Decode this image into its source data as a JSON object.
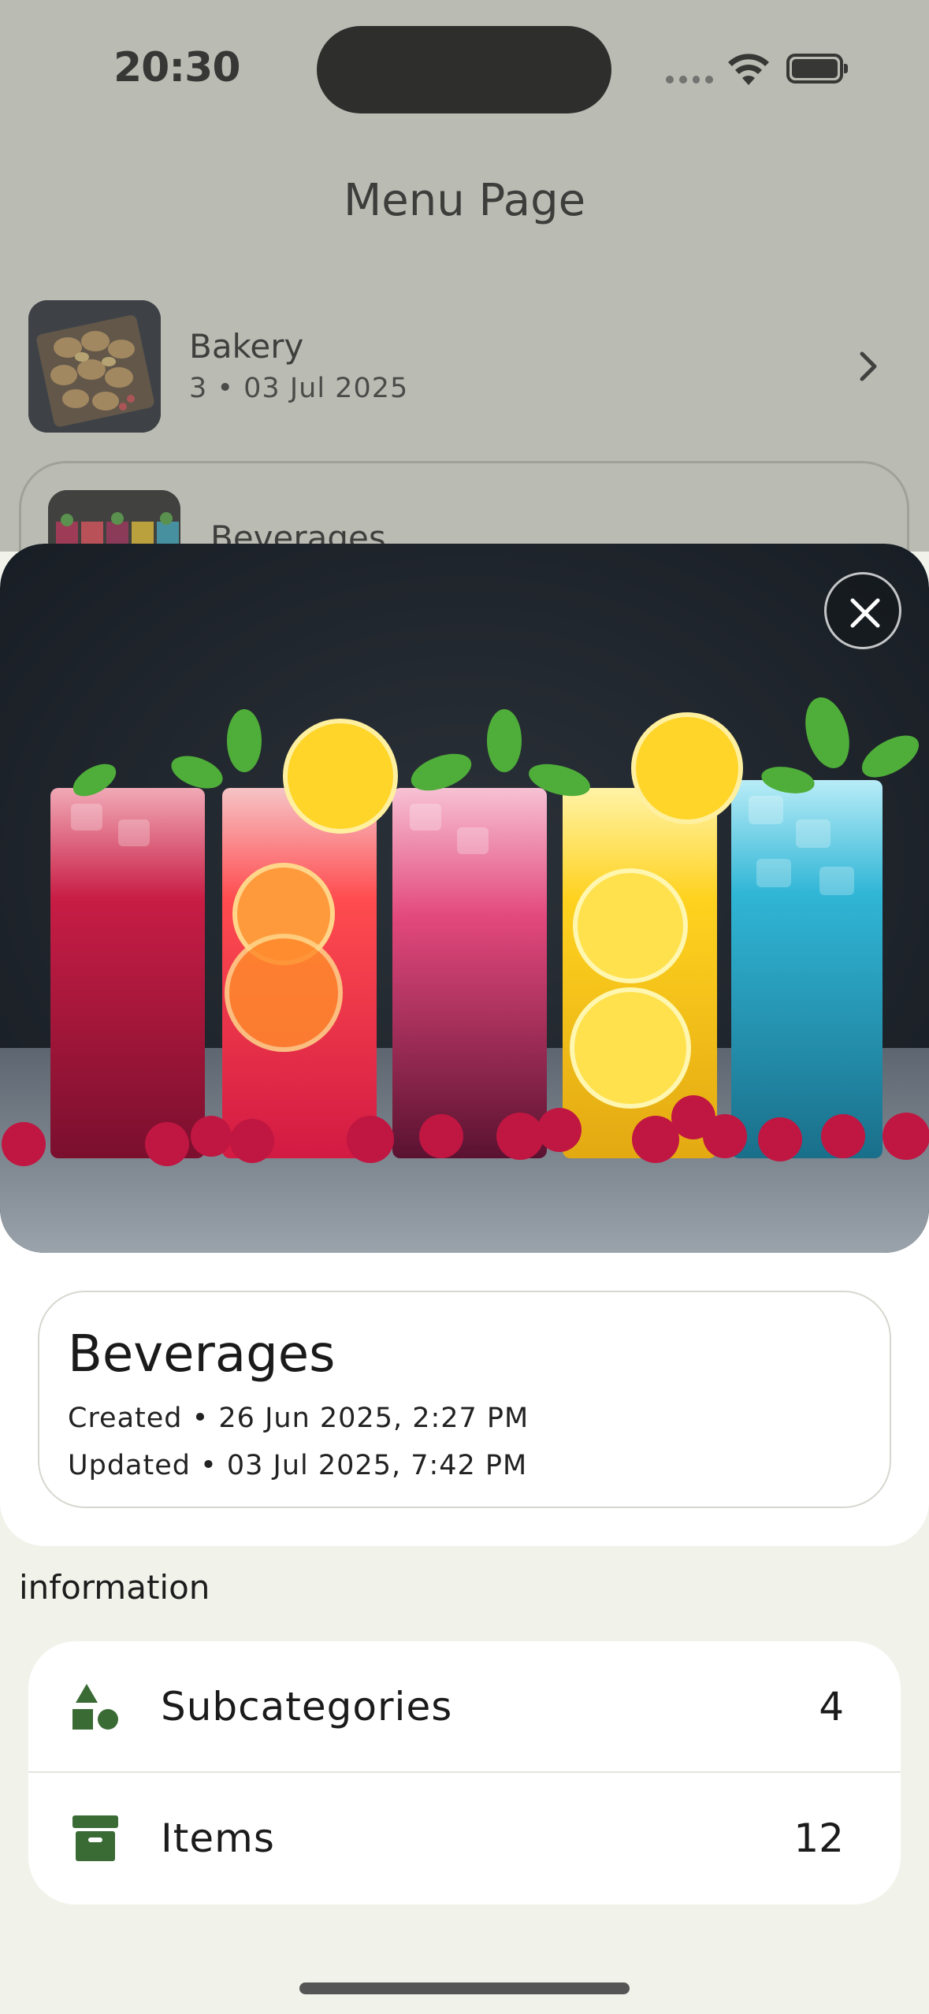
{
  "status_bar": {
    "time": "20:30"
  },
  "header": {
    "title": "Menu Page"
  },
  "categories": [
    {
      "name": "Bakery",
      "meta": "3 • 03 Jul 2025"
    },
    {
      "name": "Beverages"
    }
  ],
  "detail": {
    "title": "Beverages",
    "created": "Created • 26 Jun 2025, 2:27 PM",
    "updated": "Updated • 03 Jul 2025, 7:42 PM"
  },
  "information": {
    "label": "information",
    "rows": [
      {
        "icon": "shapes-icon",
        "label": "Subcategories",
        "value": "4"
      },
      {
        "icon": "archive-icon",
        "label": "Items",
        "value": "12"
      }
    ]
  },
  "colors": {
    "accent": "#3a6b35",
    "background": "#f1f3eb"
  }
}
